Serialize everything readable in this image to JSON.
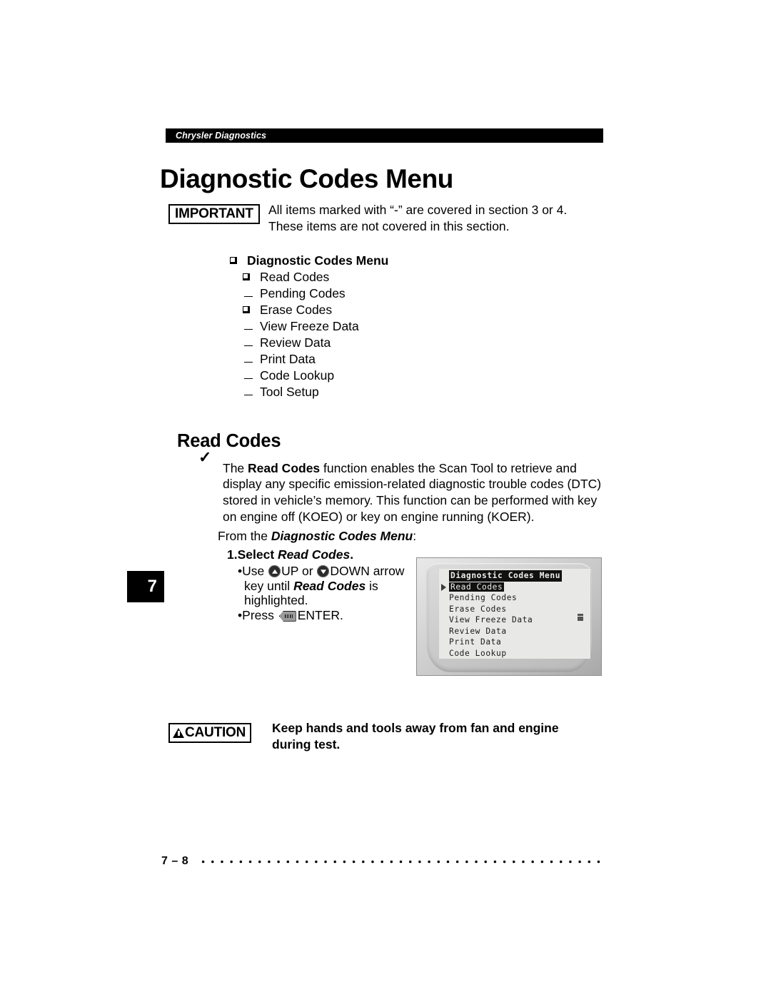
{
  "running_head": "Chrysler Diagnostics",
  "chapter_title": "Diagnostic Codes Menu",
  "important": {
    "label": "IMPORTANT",
    "line1": "All items marked with “-” are covered in section 3 or 4.",
    "line2": "These items are not covered in this section."
  },
  "outline": {
    "items": [
      {
        "label": "Diagnostic Codes Menu",
        "bullet": "square",
        "level": 0,
        "bold": true
      },
      {
        "label": "Read Codes",
        "bullet": "square",
        "level": 1,
        "bold": false
      },
      {
        "label": "Pending Codes",
        "bullet": "dash",
        "level": 1,
        "bold": false
      },
      {
        "label": "Erase Codes",
        "bullet": "square",
        "level": 1,
        "bold": false
      },
      {
        "label": "View Freeze Data",
        "bullet": "dash",
        "level": 1,
        "bold": false
      },
      {
        "label": "Review Data",
        "bullet": "dash",
        "level": 1,
        "bold": false
      },
      {
        "label": "Print Data",
        "bullet": "dash",
        "level": 1,
        "bold": false
      },
      {
        "label": "Code Lookup",
        "bullet": "dash",
        "level": 1,
        "bold": false
      },
      {
        "label": "Tool Setup",
        "bullet": "dash",
        "level": 1,
        "bold": false
      }
    ]
  },
  "section": {
    "heading": "Read Codes",
    "check_bullet": "✓",
    "paragraph_pre": "The ",
    "paragraph_bold": "Read Codes",
    "paragraph_post": " function enables the Scan Tool to retrieve and display any specific emission-related diagnostic trouble codes (DTC) stored in vehicle’s memory. This function can be performed with key on engine off (KOEO) or key on engine running (KOER)."
  },
  "procedure": {
    "from_line_pre": "From the ",
    "from_line_menu": "Diagnostic Codes Menu",
    "from_line_post": ":",
    "step_number": "1.",
    "step_pre": "Select ",
    "step_target": "Read Codes",
    "step_post": ".",
    "bullet_char": "•",
    "use_line_pre": "Use ",
    "up_label": "UP",
    "or_label": " or ",
    "down_label": "DOWN",
    "arrow_word": " arrow",
    "use_line_2_pre": "key until ",
    "use_line_2_bold": "Read Codes",
    "use_line_2_post": " is",
    "use_line_3": "highlighted.",
    "press_pre": "Press ",
    "enter_label": "ENTER."
  },
  "tool_screen": {
    "title": "Diagnostic Codes Menu",
    "cursor_glyph": "▶",
    "rows": [
      {
        "label": "Read Codes",
        "selected": true
      },
      {
        "label": "Pending Codes",
        "selected": false
      },
      {
        "label": "Erase Codes",
        "selected": false
      },
      {
        "label": "View Freeze Data",
        "selected": false
      },
      {
        "label": "Review Data",
        "selected": false
      },
      {
        "label": "Print Data",
        "selected": false
      },
      {
        "label": "Code Lookup",
        "selected": false
      }
    ]
  },
  "caution": {
    "label": "CAUTION",
    "line1": "Keep hands and tools away from fan and engine",
    "line2": "during test."
  },
  "thumb_tab": "7",
  "footer": {
    "folio": "7 – 8"
  }
}
